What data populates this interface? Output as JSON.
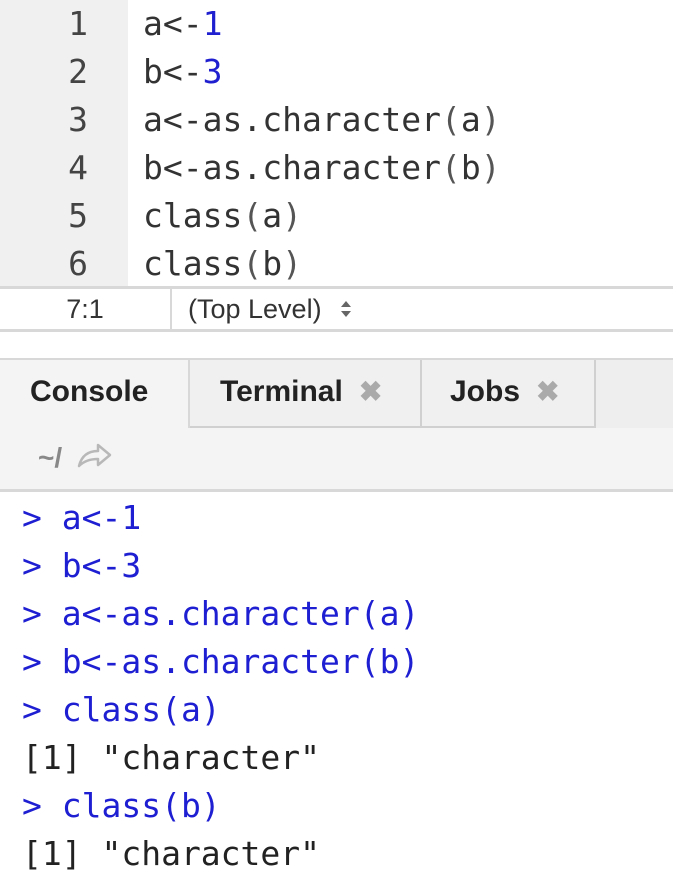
{
  "editor": {
    "lines": [
      {
        "num": "1",
        "parts": [
          {
            "t": "a<-",
            "c": "code"
          },
          {
            "t": "1",
            "c": "num"
          }
        ]
      },
      {
        "num": "2",
        "parts": [
          {
            "t": "b<-",
            "c": "code"
          },
          {
            "t": "3",
            "c": "num"
          }
        ]
      },
      {
        "num": "3",
        "parts": [
          {
            "t": "a<-as.character",
            "c": "code"
          },
          {
            "t": "(",
            "c": "paren"
          },
          {
            "t": "a",
            "c": "code"
          },
          {
            "t": ")",
            "c": "paren"
          }
        ]
      },
      {
        "num": "4",
        "parts": [
          {
            "t": "b<-as.character",
            "c": "code"
          },
          {
            "t": "(",
            "c": "paren"
          },
          {
            "t": "b",
            "c": "code"
          },
          {
            "t": ")",
            "c": "paren"
          }
        ]
      },
      {
        "num": "5",
        "parts": [
          {
            "t": "class",
            "c": "code"
          },
          {
            "t": "(",
            "c": "paren"
          },
          {
            "t": "a",
            "c": "code"
          },
          {
            "t": ")",
            "c": "paren"
          }
        ]
      },
      {
        "num": "6",
        "parts": [
          {
            "t": "class",
            "c": "code"
          },
          {
            "t": "(",
            "c": "paren"
          },
          {
            "t": "b",
            "c": "code"
          },
          {
            "t": ")",
            "c": "paren"
          }
        ]
      }
    ]
  },
  "status": {
    "position": "7:1",
    "scope": "(Top Level)",
    "scope_icon": "updown-chevron-icon"
  },
  "tabs": {
    "console": "Console",
    "terminal": "Terminal",
    "jobs": "Jobs",
    "close_glyph": "✖"
  },
  "pathbar": {
    "path": "~/",
    "arrow_icon": "forward-arrow-icon"
  },
  "console": {
    "lines": [
      {
        "type": "in",
        "text": "> a<-1"
      },
      {
        "type": "in",
        "text": "> b<-3"
      },
      {
        "type": "in",
        "text": "> a<-as.character(a)"
      },
      {
        "type": "in",
        "text": "> b<-as.character(b)"
      },
      {
        "type": "in",
        "text": "> class(a)"
      },
      {
        "type": "out",
        "text": "[1] \"character\""
      },
      {
        "type": "in",
        "text": "> class(b)"
      },
      {
        "type": "out",
        "text": "[1] \"character\""
      }
    ]
  },
  "colors": {
    "input": "#1e1ed2",
    "number": "#1f1fd0",
    "gutter": "#f0f0f0"
  }
}
